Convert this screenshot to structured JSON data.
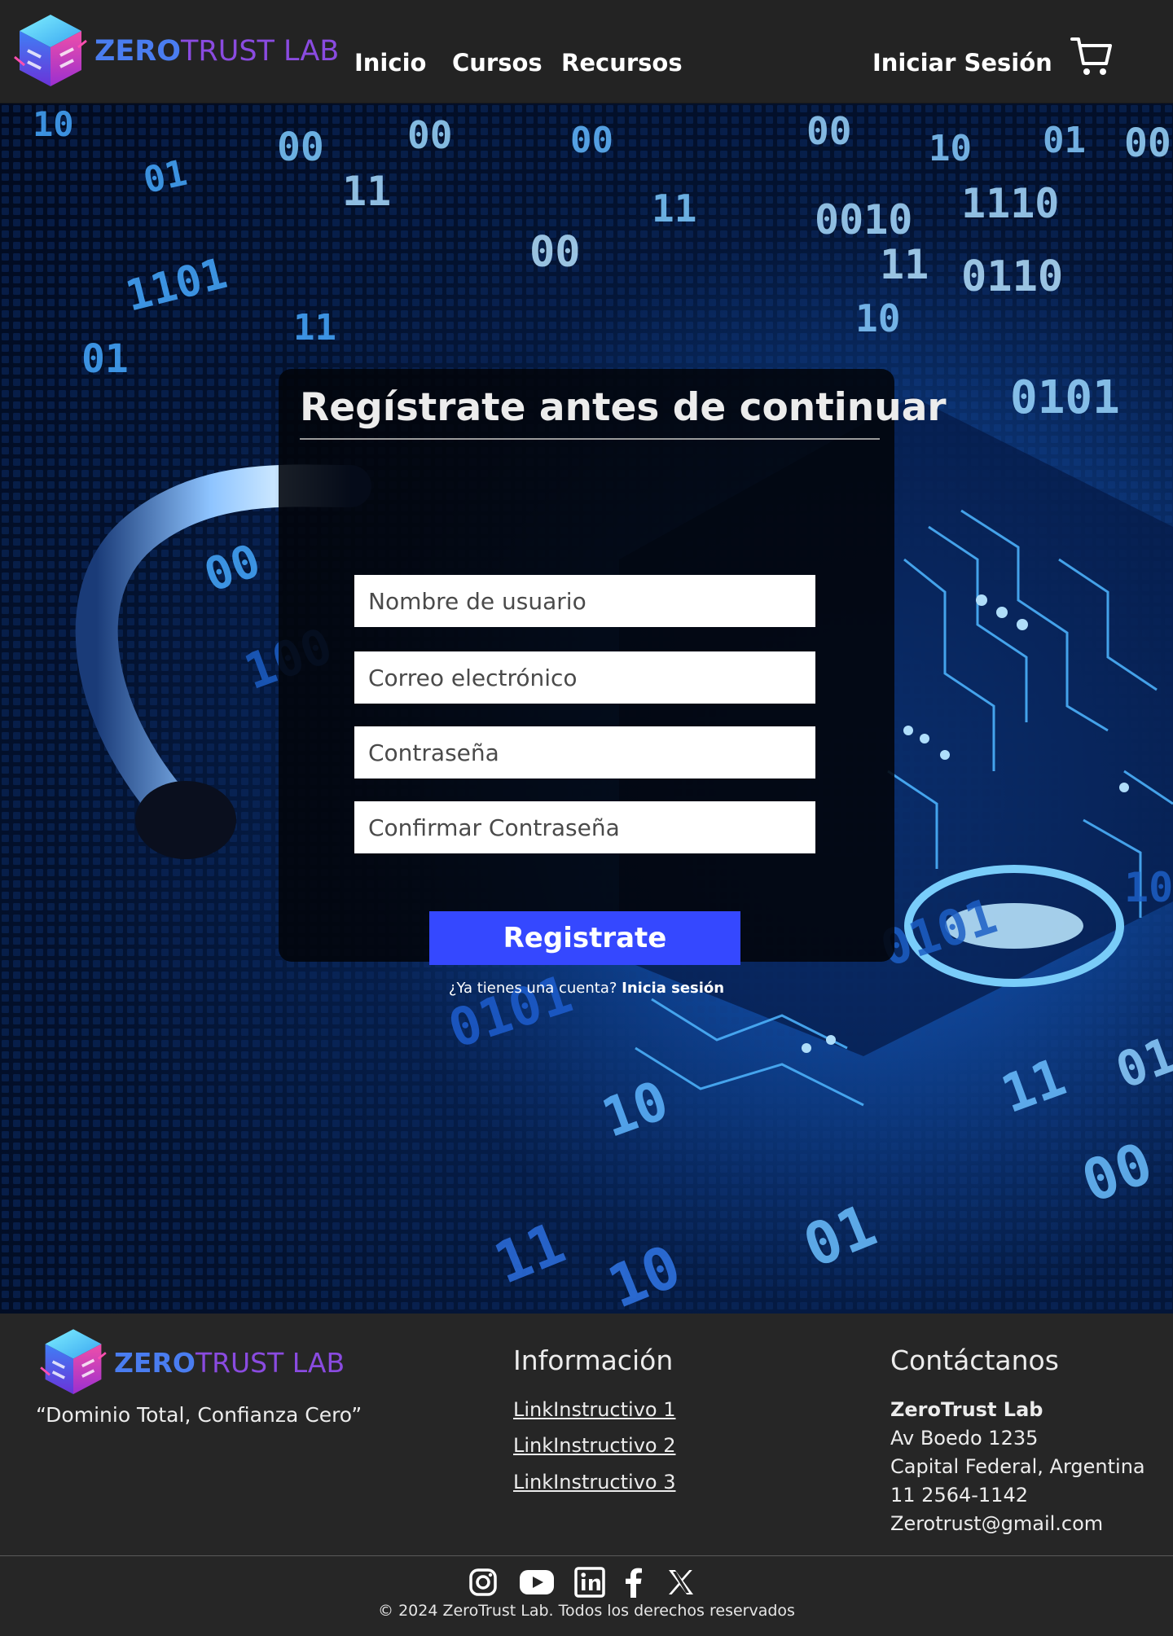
{
  "brand": {
    "logo_part1": "ZERO",
    "logo_part2": "TRUST LAB"
  },
  "nav": {
    "inicio": "Inicio",
    "cursos": "Cursos",
    "recursos": "Recursos",
    "login": "Iniciar Sesión"
  },
  "cart": {
    "icon": "shopping-cart-icon"
  },
  "form": {
    "title": "Regístrate antes de continuar",
    "username_placeholder": "Nombre de usuario",
    "email_placeholder": "Correo electrónico",
    "password_placeholder": "Contraseña",
    "confirm_placeholder": "Confirmar Contraseña",
    "submit_label": "Registrate",
    "login_prompt": "¿Ya tienes una cuenta?",
    "login_link": "Inicia sesión"
  },
  "footer": {
    "slogan": "“Dominio Total, Confianza Cero”",
    "info_title": "Información",
    "links": [
      "LinkInstructivo 1",
      "LinkInstructivo 2",
      "LinkInstructivo 3"
    ],
    "contact_title": "Contáctanos",
    "contact": {
      "company": "ZeroTrust Lab",
      "address": "Av Boedo 1235",
      "city": "Capital Federal, Argentina",
      "phone": "11 2564-1142",
      "email": "Zerotrust@gmail.com"
    },
    "socials": [
      "instagram-icon",
      "youtube-icon",
      "linkedin-icon",
      "facebook-icon",
      "x-icon"
    ],
    "copyright": "© 2024 ZeroTrust Lab. Todos los derechos reservados"
  },
  "colors": {
    "header_bg": "#232323",
    "accent_button": "#3548ff",
    "logo_blue": "#4a7df0",
    "logo_purple": "#8a4be0",
    "footer_bg": "#262626"
  }
}
